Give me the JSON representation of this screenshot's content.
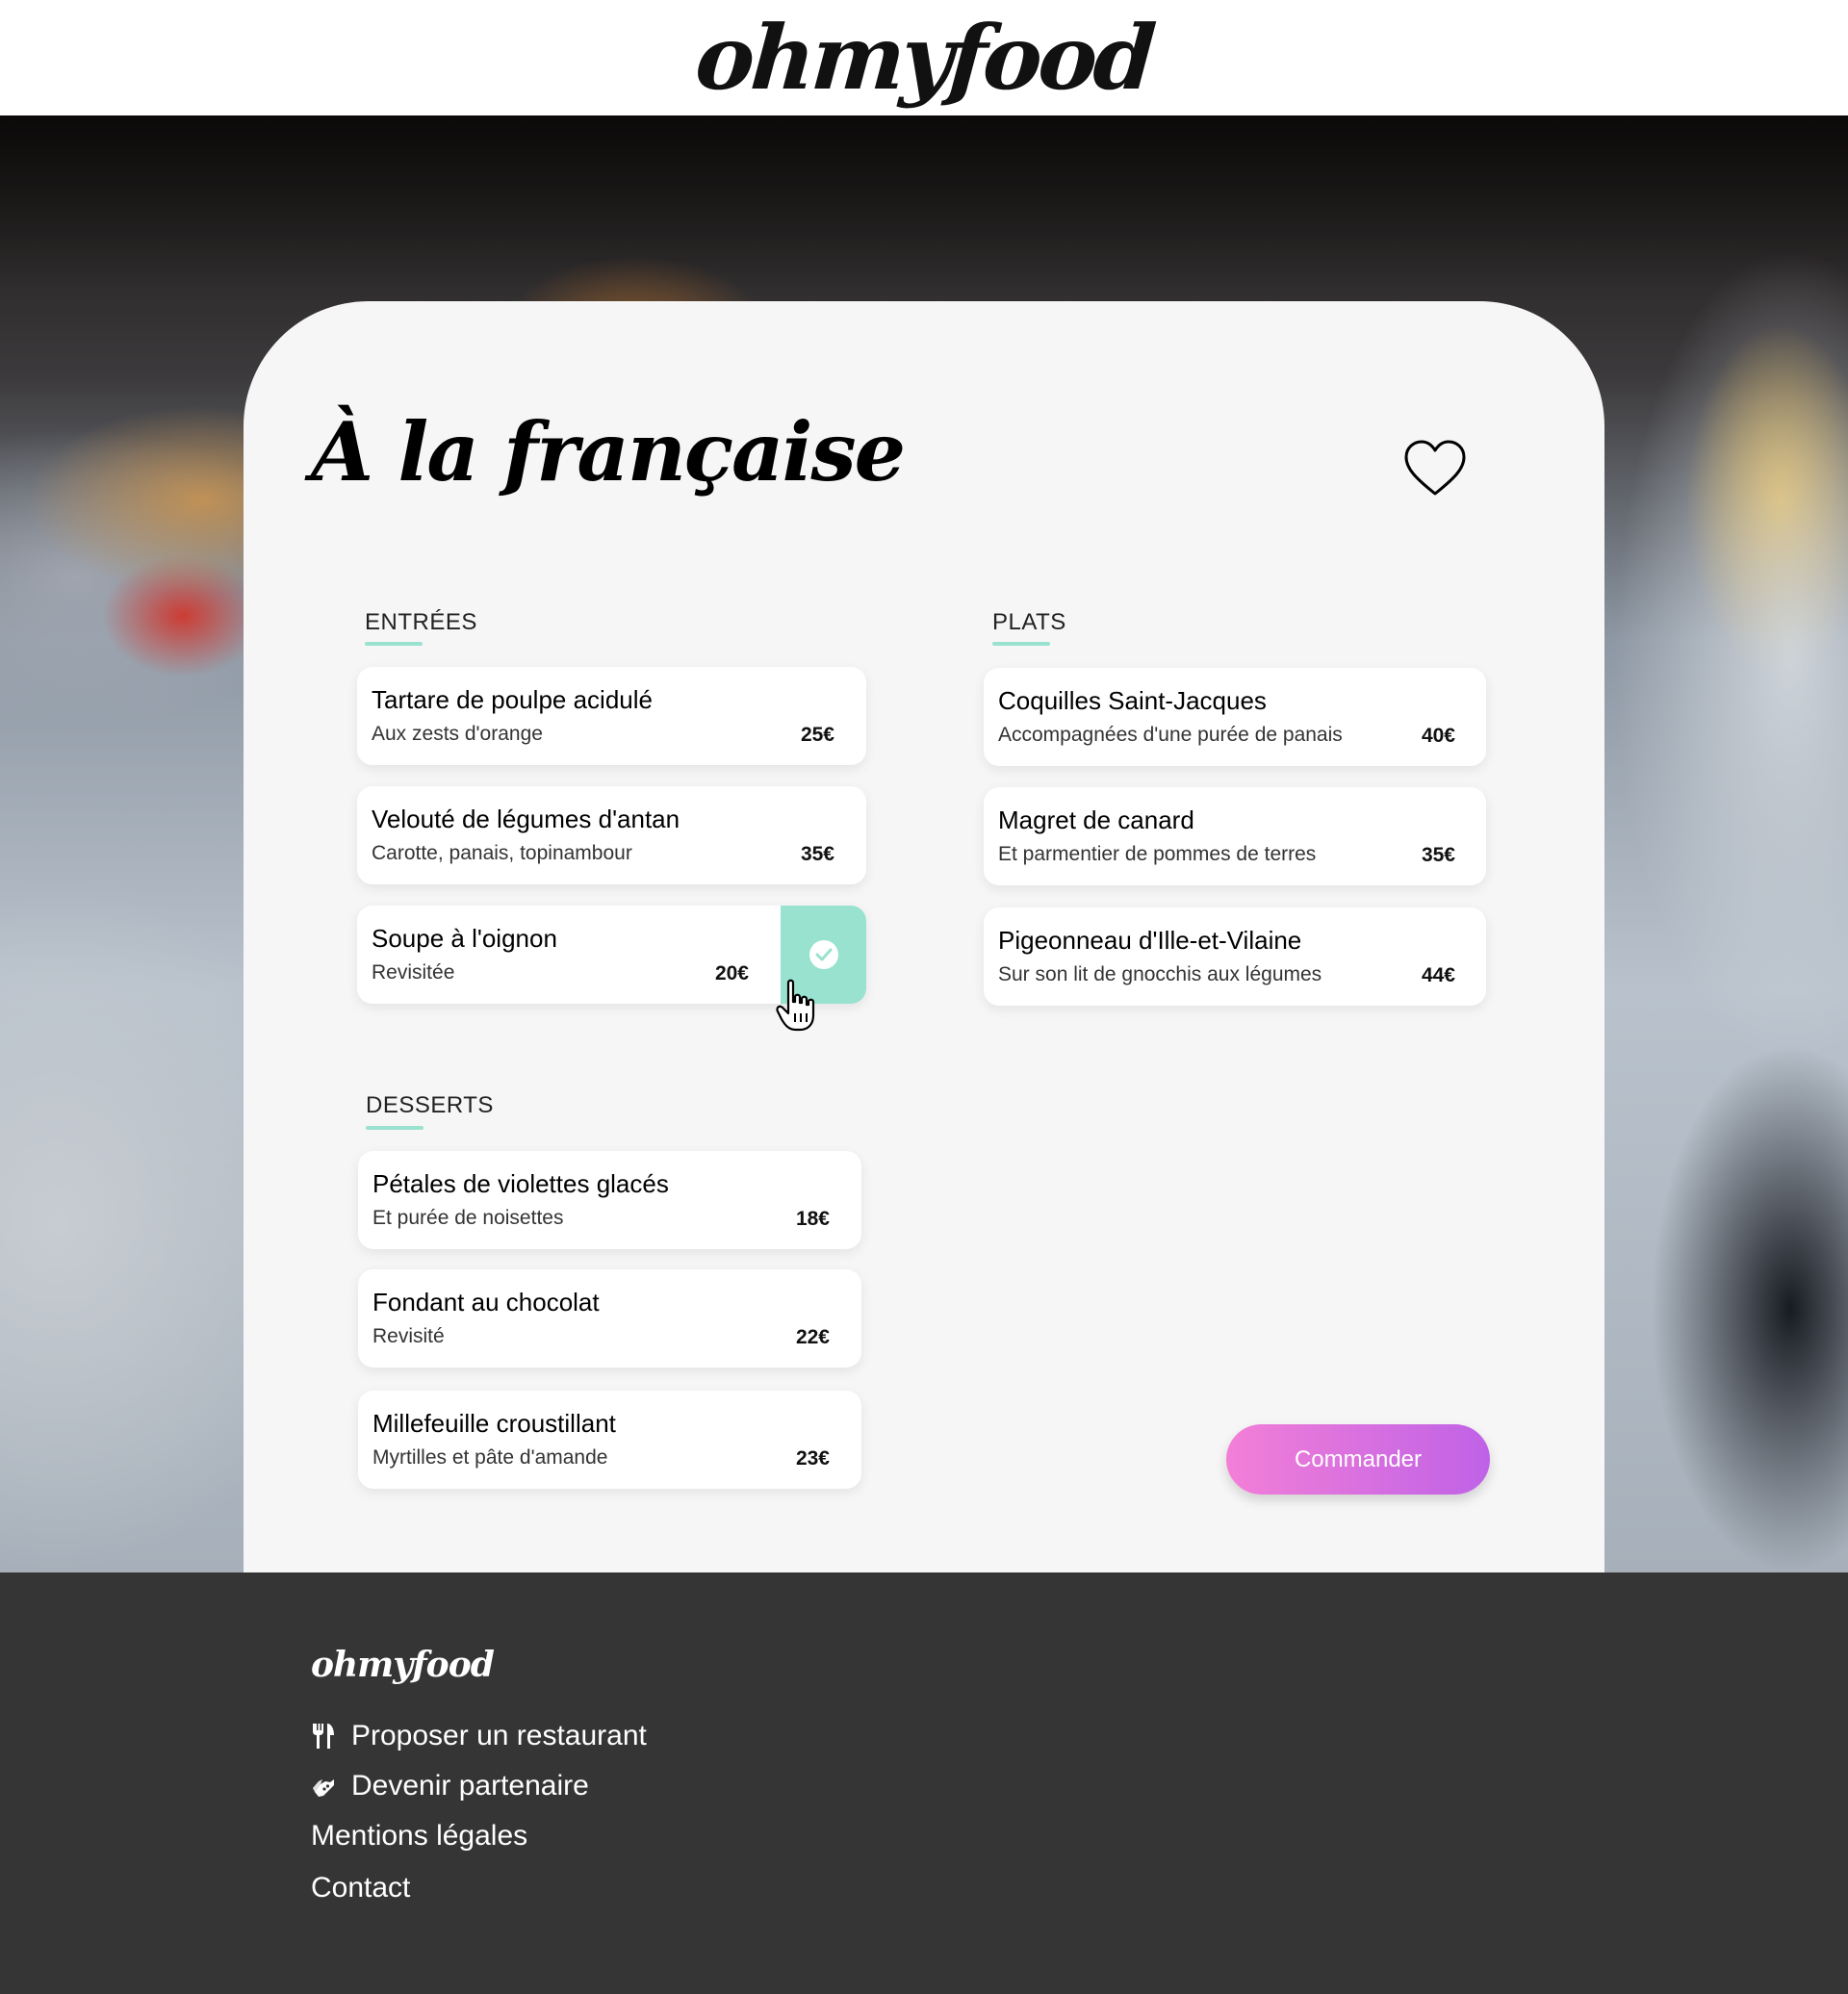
{
  "header": {
    "logo": "ohmyfood"
  },
  "menu": {
    "title": "À la française",
    "favorite_icon": "heart-outline-icon",
    "sections": {
      "entrees": {
        "heading": "ENTRÉES",
        "items": [
          {
            "name": "Tartare de poulpe acidulé",
            "desc": "Aux zests d'orange",
            "price": "25€"
          },
          {
            "name": "Velouté de légumes d'antan",
            "desc": "Carotte, panais, topinambour",
            "price": "35€"
          },
          {
            "name": "Soupe à l'oignon",
            "desc": "Revisitée",
            "price": "20€",
            "selected": true
          }
        ]
      },
      "plats": {
        "heading": "PLATS",
        "items": [
          {
            "name": "Coquilles Saint-Jacques",
            "desc": "Accompagnées d'une purée de panais",
            "price": "40€"
          },
          {
            "name": "Magret de canard",
            "desc": "Et parmentier de pommes de terres",
            "price": "35€"
          },
          {
            "name": "Pigeonneau d'Ille-et-Vilaine",
            "desc": "Sur son lit de gnocchis aux légumes",
            "price": "44€"
          }
        ]
      },
      "desserts": {
        "heading": "DESSERTS",
        "items": [
          {
            "name": "Pétales de violettes glacés",
            "desc": "Et purée de noisettes",
            "price": "18€"
          },
          {
            "name": "Fondant au chocolat",
            "desc": "Revisité",
            "price": "22€"
          },
          {
            "name": "Millefeuille croustillant",
            "desc": "Myrtilles et pâte d'amande",
            "price": "23€"
          }
        ]
      }
    },
    "order_button": "Commander"
  },
  "footer": {
    "logo": "ohmyfood",
    "links": [
      {
        "label": "Proposer un restaurant",
        "icon": "utensils-icon"
      },
      {
        "label": "Devenir partenaire",
        "icon": "handshake-icon"
      },
      {
        "label": "Mentions légales"
      },
      {
        "label": "Contact"
      }
    ]
  },
  "colors": {
    "accent_mint": "#99e2d0",
    "button_gradient_start": "#f37fd7",
    "button_gradient_end": "#bf62e7",
    "footer_bg": "#353535",
    "card_bg": "#f6f6f6"
  }
}
